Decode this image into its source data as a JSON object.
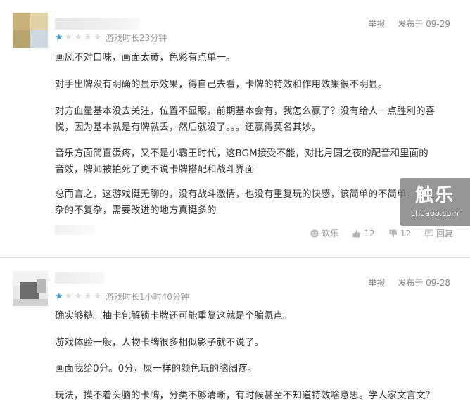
{
  "reviews": [
    {
      "rating": 1,
      "rating_max": 5,
      "playtime": "游戏时长23分钟",
      "report_label": "举报",
      "date": "发布于 09-29",
      "paragraphs": [
        "画风不对口味，画面太黄，色彩有点单一。",
        "对手出牌没有明确的显示效果，得自己去看，卡牌的特效和作用效果很不明显。",
        "对方血量基本没去关注，位置不显眼，前期基本会有，我怎么赢了？没有给人一点胜利的喜",
        "悦，因为基本就是有牌就丢，然后就没了。。。还赢得莫名其妙。",
        "音乐方面简直蛋疼，又不是小霸王时代，这BGM接受不能，对比月圆之夜的配音和里面的",
        "音效，牌师被拍死了更不说卡牌搭配和战斗界面",
        "总而言之，这游戏挺无聊的，没有战斗激情，也没有重复玩的快感，该简单的不简单，该复",
        "杂的不复杂，需要改进的地方真挺多的"
      ],
      "actions": {
        "happy_label": "欢乐",
        "like_count": "12",
        "dislike_count": "12",
        "reply_label": "回复"
      }
    },
    {
      "rating": 1,
      "rating_max": 5,
      "playtime": "游戏时长1小时40分钟",
      "report_label": "举报",
      "date": "发布于 09-28",
      "paragraphs": [
        "确实够糙。抽卡包解锁卡牌还可能重复这就是个骗氪点。",
        "游戏体验一般，人物卡牌很多相似影子就不说了。",
        "画面我给0分。0分，屎一样的颜色玩的脑阔疼。",
        "玩法，摸不着头脑的卡牌，分类不够清晰，有时候甚至不知道特效啥意思。学人家文言文？"
      ]
    }
  ],
  "watermark": {
    "main": "触乐",
    "sub": "chuapp.com"
  }
}
